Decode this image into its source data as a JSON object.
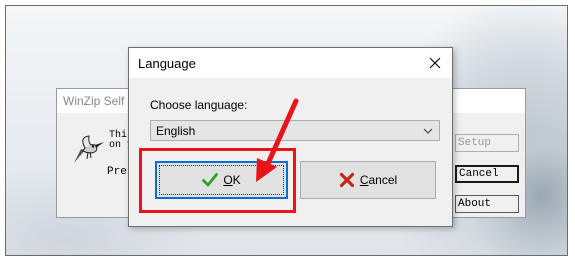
{
  "background_window": {
    "title": "WinZip Self",
    "text_line1": "This",
    "text_line2": "on y",
    "text_line3": "Pres",
    "buttons": {
      "setup": "Setup",
      "cancel": "Cancel",
      "about": "About"
    }
  },
  "dialog": {
    "title": "Language",
    "close_glyph": "✕",
    "label": "Choose language:",
    "select": {
      "value": "English"
    },
    "ok_button": {
      "mnemonic": "O",
      "rest": "K",
      "icon": "check-icon"
    },
    "cancel_button": {
      "mnemonic": "C",
      "rest": "ancel",
      "icon": "x-icon"
    }
  },
  "annotation": {
    "highlight_color": "#e8141b",
    "arrow_color": "#e8141b"
  },
  "colors": {
    "ok_focus_border": "#0a6fd0",
    "check_green": "#2aa52a",
    "cancel_x_red": "#c4261d"
  }
}
